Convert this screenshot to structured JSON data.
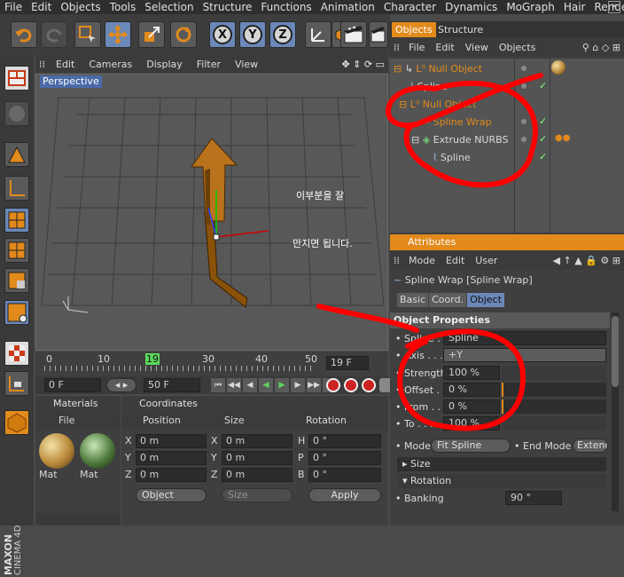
{
  "menubar": {
    "items": [
      "File",
      "Edit",
      "Objects",
      "Tools",
      "Selection",
      "Structure",
      "Functions",
      "Animation",
      "Character",
      "Dynamics",
      "MoGraph",
      "Hair",
      "Render"
    ]
  },
  "toolbar": {
    "axis_x": "X",
    "axis_y": "Y",
    "axis_z": "Z"
  },
  "viewport": {
    "menu": [
      "Edit",
      "Cameras",
      "Display",
      "Filter",
      "View"
    ],
    "label": "Perspective"
  },
  "annotation": {
    "line1": "이부분을 잘",
    "line2": "만지면 됩니다."
  },
  "timeline": {
    "ticks": [
      "0",
      "10",
      "19",
      "30",
      "40",
      "50"
    ],
    "current_frame": "19 F"
  },
  "transport": {
    "start": "0 F",
    "end": "50 F"
  },
  "materials": {
    "title": "Materials",
    "menu": "File",
    "items": [
      "Mat",
      "Mat"
    ]
  },
  "coordinates": {
    "title": "Coordinates",
    "headers": [
      "Position",
      "Size",
      "Rotation"
    ],
    "rows": [
      {
        "a": "X",
        "pos": "0 m",
        "b": "X",
        "size": "0 m",
        "c": "H",
        "rot": "0 °"
      },
      {
        "a": "Y",
        "pos": "0 m",
        "b": "Y",
        "size": "0 m",
        "c": "P",
        "rot": "0 °"
      },
      {
        "a": "Z",
        "pos": "0 m",
        "b": "Z",
        "size": "0 m",
        "c": "B",
        "rot": "0 °"
      }
    ],
    "mode": "Object",
    "size_mode": "Size",
    "apply": "Apply"
  },
  "objects_panel": {
    "tabs": [
      "Objects",
      "Structure"
    ],
    "menu": [
      "File",
      "Edit",
      "View",
      "Objects"
    ],
    "items": [
      "Null Object",
      "Spline",
      "Null Object",
      "Spline Wrap",
      "Extrude NURBS",
      "Spline"
    ]
  },
  "attributes": {
    "title": "Attributes",
    "menu": [
      "Mode",
      "Edit",
      "User"
    ],
    "object_name": "Spline Wrap [Spline Wrap]",
    "tabs": [
      "Basic",
      "Coord.",
      "Object"
    ],
    "section": "Object Properties",
    "spline_label": "Spline . .",
    "spline_value": "Spline",
    "axis_label": "Axis . . . .",
    "axis_value": "+Y",
    "strength_label": "Strength",
    "strength_value": "100 %",
    "offset_label": "Offset . .",
    "offset_value": "0 %",
    "from_label": "From . . .",
    "from_value": "0 %",
    "to_label": "To . . . .",
    "to_value": "100 %",
    "mode_label": "Mode",
    "mode_value": "Fit Spline",
    "endmode_label": "End Mode",
    "endmode_value": "Extend",
    "size_section": "Size",
    "rotation_section": "Rotation",
    "banking_label": "Banking",
    "banking_value": "90 °"
  },
  "brand": {
    "line1": "MAXON",
    "line2": "CINEMA 4D"
  },
  "colors": {
    "accent": "#e28a1c",
    "annotation": "#ff0000",
    "selection": "#6a88b8"
  }
}
